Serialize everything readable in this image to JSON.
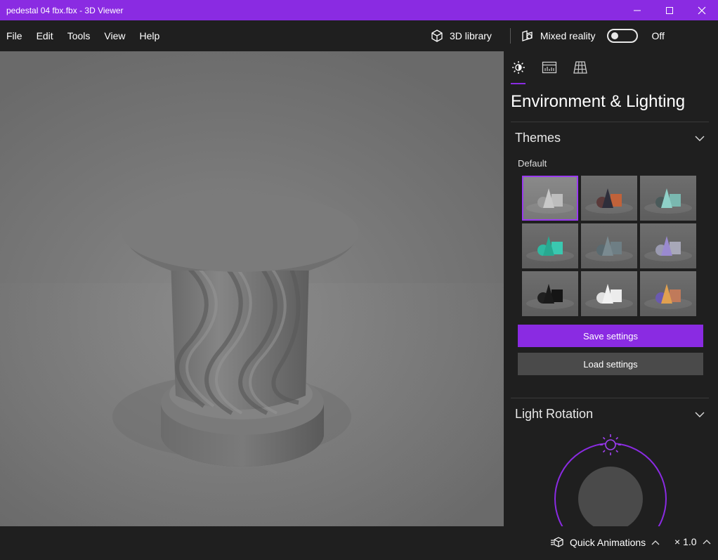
{
  "window": {
    "title": "pedestal 04 fbx.fbx - 3D Viewer",
    "controls": [
      "minimize-icon",
      "maximize-icon",
      "close-icon"
    ],
    "accent_color": "#8a2be2"
  },
  "menu": {
    "items": [
      "File",
      "Edit",
      "Tools",
      "View",
      "Help"
    ],
    "library_label": "3D library",
    "mixed_reality_label": "Mixed reality",
    "mixed_reality_state": "Off",
    "mixed_reality_enabled": false
  },
  "panel": {
    "tabs": [
      {
        "icon": "lighting-icon",
        "selected": true
      },
      {
        "icon": "stats-icon",
        "selected": false
      },
      {
        "icon": "grid-icon",
        "selected": false
      }
    ],
    "title": "Environment & Lighting",
    "themes": {
      "label": "Themes",
      "selected_name": "Default",
      "selected_index": 0,
      "swatches": [
        {
          "sphere": "#9a9a9a",
          "cone": "#c8c8c8",
          "cube": "#bdbdbd"
        },
        {
          "sphere": "#5a3a3a",
          "cone": "#2e2e3a",
          "cube": "#c0623a"
        },
        {
          "sphere": "#4a5a5a",
          "cone": "#8fd0c8",
          "cube": "#7ab8b0"
        },
        {
          "sphere": "#2fb8a0",
          "cone": "#28a890",
          "cube": "#3ac8b0"
        },
        {
          "sphere": "#5a6a70",
          "cone": "#7a8a90",
          "cube": "#6e7e84"
        },
        {
          "sphere": "#9a9ab0",
          "cone": "#9a8ad0",
          "cube": "#a8a8b8"
        },
        {
          "sphere": "#202020",
          "cone": "#1a1a1a",
          "cube": "#151515"
        },
        {
          "sphere": "#e0e0e0",
          "cone": "#f0f0f0",
          "cube": "#ececec"
        },
        {
          "sphere": "#6a5ab0",
          "cone": "#e0a050",
          "cube": "#c07a5a"
        }
      ],
      "save_label": "Save settings",
      "load_label": "Load settings"
    },
    "light_rotation": {
      "label": "Light Rotation"
    }
  },
  "bottom": {
    "quick_animations_label": "Quick Animations",
    "speed_label": "× 1.0"
  }
}
